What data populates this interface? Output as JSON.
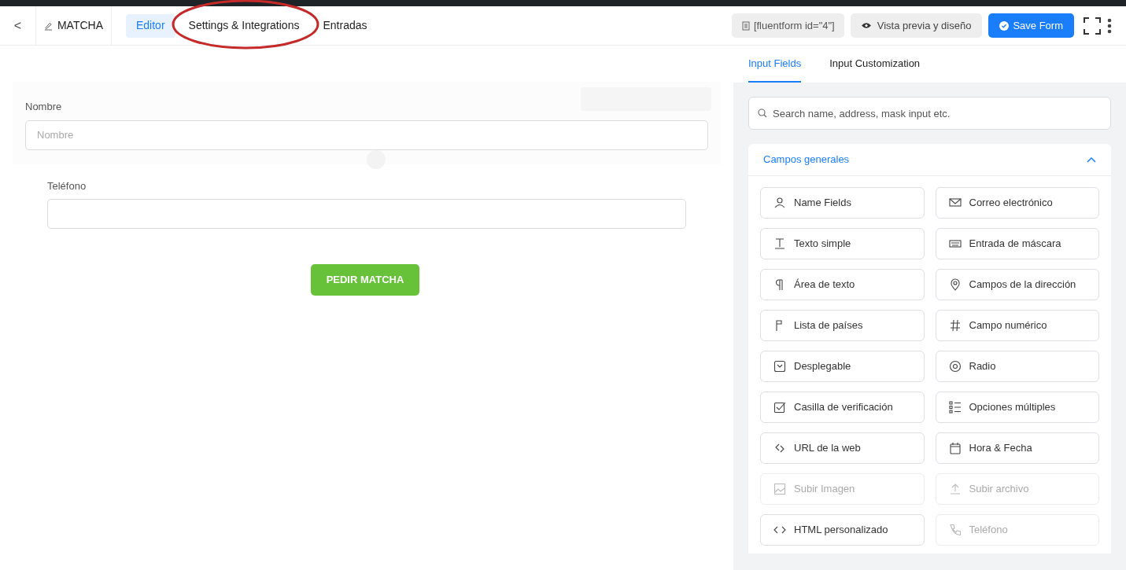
{
  "header": {
    "back": "<",
    "form_name": "MATCHA",
    "tabs": [
      {
        "label": "Editor",
        "selected": true,
        "circled": false
      },
      {
        "label": "Settings & Integrations",
        "selected": false,
        "circled": true
      },
      {
        "label": "Entradas",
        "selected": false,
        "circled": false
      }
    ],
    "shortcode": "[fluentform id=\"4\"]",
    "preview": "Vista previa y diseño",
    "save": "Save Form"
  },
  "form": {
    "fields": [
      {
        "label": "Nombre",
        "placeholder": "Nombre",
        "hovered": true
      },
      {
        "label": "Teléfono",
        "hovered": false
      }
    ],
    "submit": "PEDIR MATCHA"
  },
  "panel": {
    "tabs": [
      {
        "label": "Input Fields",
        "selected": true
      },
      {
        "label": "Input Customization",
        "selected": false
      }
    ],
    "search": {
      "placeholder": "Search name, address, mask input etc."
    },
    "section": {
      "title": "Campos generales",
      "expanded": true
    },
    "items": [
      {
        "label": "Name Fields",
        "disabled": false
      },
      {
        "label": "Correo electrónico",
        "disabled": false
      },
      {
        "label": "Texto simple",
        "disabled": false
      },
      {
        "label": "Entrada de máscara",
        "disabled": false
      },
      {
        "label": "Área de texto",
        "disabled": false
      },
      {
        "label": "Campos de la dirección",
        "disabled": false
      },
      {
        "label": "Lista de países",
        "disabled": false
      },
      {
        "label": "Campo numérico",
        "disabled": false
      },
      {
        "label": "Desplegable",
        "disabled": false
      },
      {
        "label": "Radio",
        "disabled": false
      },
      {
        "label": "Casilla de verificación",
        "disabled": false
      },
      {
        "label": "Opciones múltiples",
        "disabled": false
      },
      {
        "label": "URL de la web",
        "disabled": false
      },
      {
        "label": "Hora & Fecha",
        "disabled": false
      },
      {
        "label": "Subir Imagen",
        "disabled": true
      },
      {
        "label": "Subir archivo",
        "disabled": true
      },
      {
        "label": "HTML personalizado",
        "disabled": false
      },
      {
        "label": "Teléfono",
        "disabled": true
      }
    ]
  }
}
